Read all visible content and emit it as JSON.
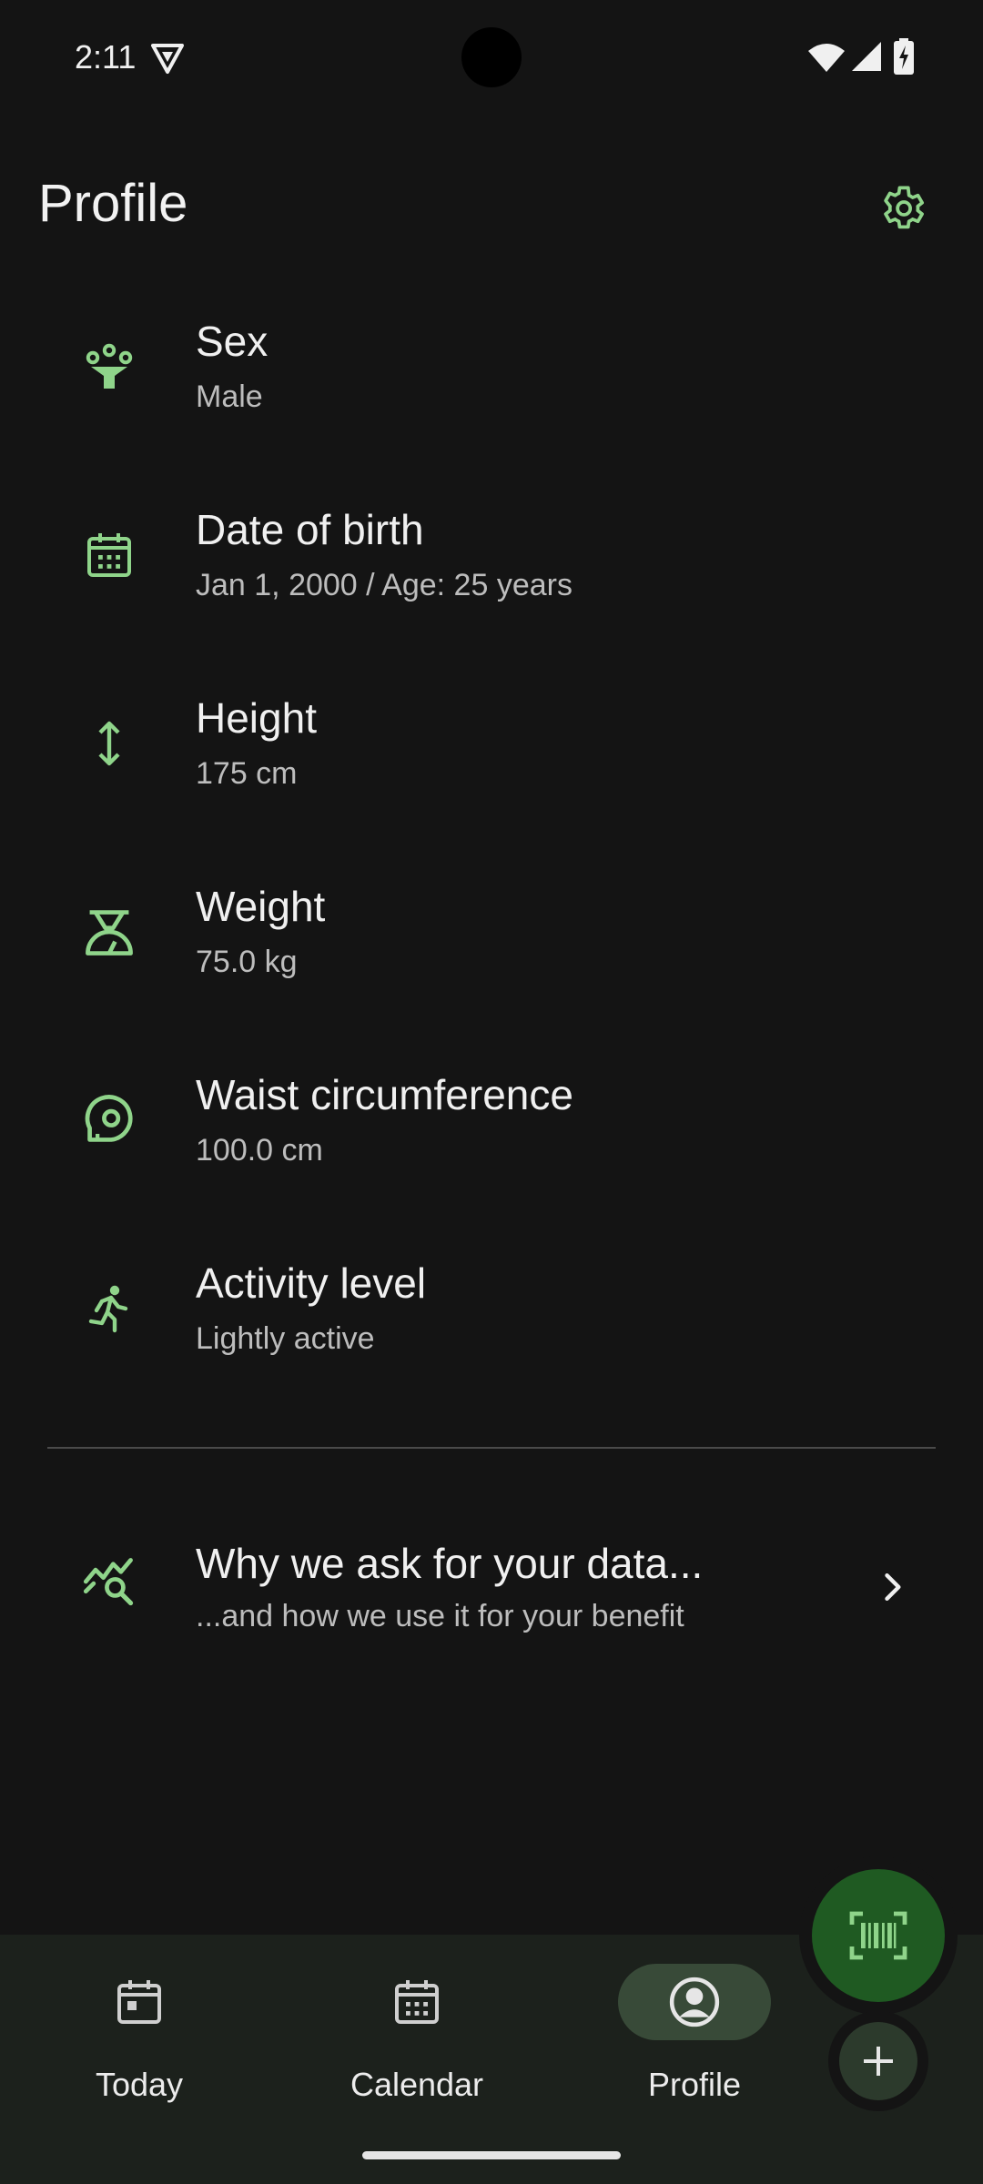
{
  "status_bar": {
    "time": "2:11"
  },
  "header": {
    "title": "Profile",
    "settings_icon": "gear-icon"
  },
  "profile_items": [
    {
      "id": "sex",
      "icon": "gender-icon",
      "title": "Sex",
      "value": "Male"
    },
    {
      "id": "date-of-birth",
      "icon": "calendar-icon",
      "title": "Date of birth",
      "value": "Jan 1, 2000 / Age: 25 years"
    },
    {
      "id": "height",
      "icon": "height-arrows-icon",
      "title": "Height",
      "value": "175 cm"
    },
    {
      "id": "weight",
      "icon": "scale-icon",
      "title": "Weight",
      "value": "75.0 kg"
    },
    {
      "id": "waist",
      "icon": "measuring-tape-icon",
      "title": "Waist circumference",
      "value": "100.0 cm"
    },
    {
      "id": "activity",
      "icon": "running-person-icon",
      "title": "Activity level",
      "value": "Lightly active"
    }
  ],
  "info_row": {
    "title": "Why we ask for your data...",
    "subtitle": "...and how we use it for your benefit",
    "icon": "chart-search-icon"
  },
  "fab": {
    "scan_icon": "barcode-scan-icon",
    "add_icon": "plus-icon"
  },
  "bottom_nav": [
    {
      "id": "today",
      "label": "Today",
      "icon": "calendar-today-icon",
      "active": false
    },
    {
      "id": "calendar",
      "label": "Calendar",
      "icon": "calendar-icon",
      "active": false
    },
    {
      "id": "profile",
      "label": "Profile",
      "icon": "account-circle-icon",
      "active": true
    }
  ],
  "colors": {
    "accent": "#8fd48a",
    "background": "#141414",
    "nav_background": "#1c211c",
    "fab_background": "#1f5a22"
  }
}
